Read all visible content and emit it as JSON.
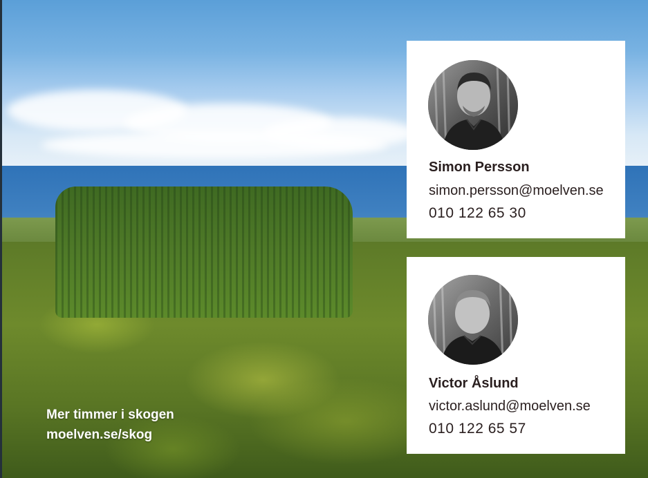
{
  "caption": {
    "line1": "Mer timmer i skogen",
    "line2": "moelven.se/skog"
  },
  "contacts": [
    {
      "name": "Simon Persson",
      "email": "simon.persson@moelven.se",
      "phone": "010 122 65 30"
    },
    {
      "name": "Victor Åslund",
      "email": "victor.aslund@moelven.se",
      "phone": "010 122 65 57"
    }
  ]
}
